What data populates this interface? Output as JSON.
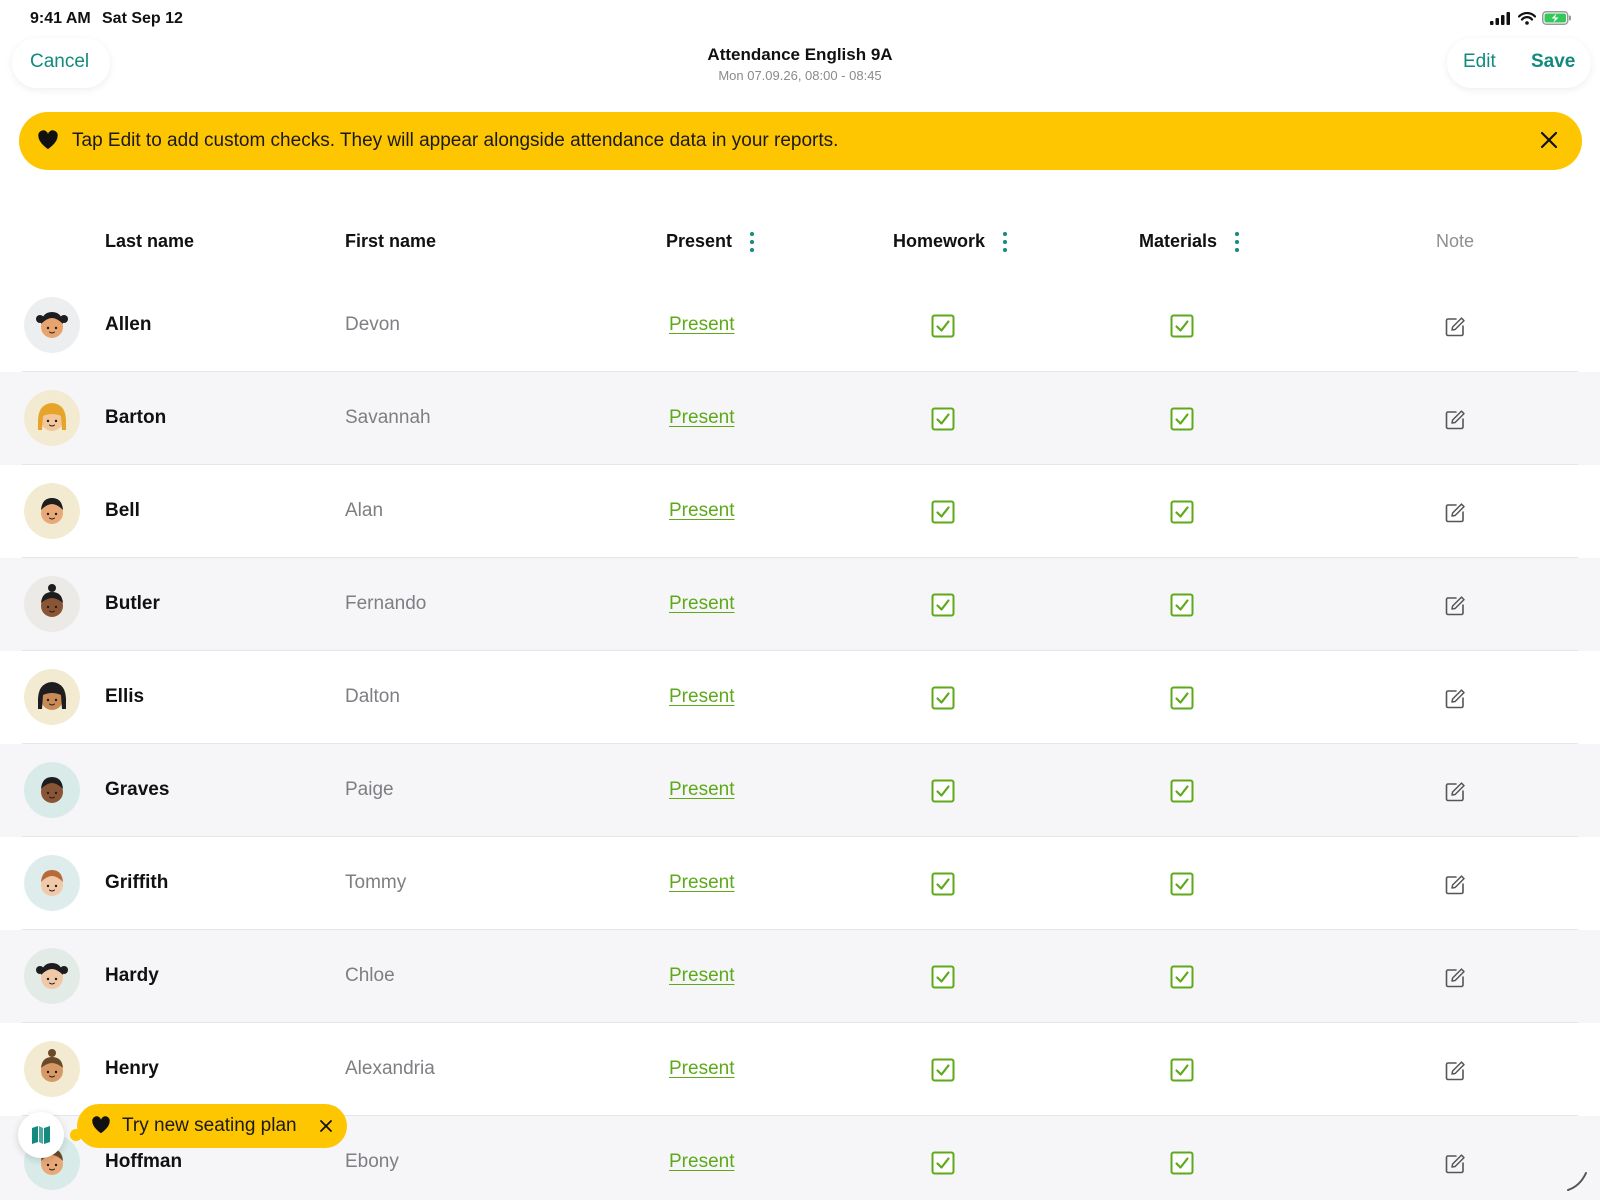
{
  "status_bar": {
    "time": "9:41 AM",
    "date": "Sat Sep 12",
    "battery_color": "#34c759"
  },
  "nav": {
    "cancel_label": "Cancel",
    "title": "Attendance English 9A",
    "subtitle": "Mon 07.09.26, 08:00 - 08:45",
    "edit_label": "Edit",
    "save_label": "Save",
    "accent_color": "#128a7e"
  },
  "banner": {
    "text": "Tap Edit to add custom checks. They will appear alongside attendance data in your reports.",
    "icon": "heart-icon",
    "close_icon": "close-icon",
    "color": "#fec501"
  },
  "table": {
    "headers": {
      "last_name": "Last name",
      "first_name": "First name",
      "present": "Present",
      "homework": "Homework",
      "materials": "Materials",
      "note": "Note"
    },
    "status_color": "#5ea91a",
    "rows": [
      {
        "last": "Allen",
        "first": "Devon",
        "status": "Present",
        "homework": true,
        "materials": true,
        "avatar": {
          "bg": "#eceef0",
          "skin": "#e7a46e",
          "hair": "#1d1d1f",
          "style": "bun-side"
        }
      },
      {
        "last": "Barton",
        "first": "Savannah",
        "status": "Present",
        "homework": true,
        "materials": true,
        "avatar": {
          "bg": "#f3ead2",
          "skin": "#f2c79c",
          "hair": "#e6a52a",
          "style": "long"
        }
      },
      {
        "last": "Bell",
        "first": "Alan",
        "status": "Present",
        "homework": true,
        "materials": true,
        "avatar": {
          "bg": "#f3ead2",
          "skin": "#e9a878",
          "hair": "#1d1d1f",
          "style": "short"
        }
      },
      {
        "last": "Butler",
        "first": "Fernando",
        "status": "Present",
        "homework": true,
        "materials": true,
        "avatar": {
          "bg": "#eceae6",
          "skin": "#8a5535",
          "hair": "#1d1d1f",
          "style": "topknot"
        }
      },
      {
        "last": "Ellis",
        "first": "Dalton",
        "status": "Present",
        "homework": true,
        "materials": true,
        "avatar": {
          "bg": "#f3ead2",
          "skin": "#c98a57",
          "hair": "#1d1d1f",
          "style": "long"
        }
      },
      {
        "last": "Graves",
        "first": "Paige",
        "status": "Present",
        "homework": true,
        "materials": true,
        "avatar": {
          "bg": "#d8ebe9",
          "skin": "#8a5535",
          "hair": "#1d1d1f",
          "style": "short"
        }
      },
      {
        "last": "Griffith",
        "first": "Tommy",
        "status": "Present",
        "homework": true,
        "materials": true,
        "avatar": {
          "bg": "#dfecec",
          "skin": "#f2c9a8",
          "hair": "#b86a3a",
          "style": "short"
        }
      },
      {
        "last": "Hardy",
        "first": "Chloe",
        "status": "Present",
        "homework": true,
        "materials": true,
        "avatar": {
          "bg": "#e3ebe6",
          "skin": "#f2c9a8",
          "hair": "#1d1d1f",
          "style": "bun-side"
        }
      },
      {
        "last": "Henry",
        "first": "Alexandria",
        "status": "Present",
        "homework": true,
        "materials": true,
        "avatar": {
          "bg": "#f3ead2",
          "skin": "#d79a66",
          "hair": "#6b4a2a",
          "style": "topknot"
        }
      },
      {
        "last": "Hoffman",
        "first": "Ebony",
        "status": "Present",
        "homework": true,
        "materials": true,
        "avatar": {
          "bg": "#d8ebe9",
          "skin": "#e9a878",
          "hair": "#6b4a2a",
          "style": "short"
        }
      }
    ]
  },
  "seating_toast": {
    "text": "Try new seating plan",
    "icon": "heart-icon",
    "map_icon": "map-icon",
    "close_icon": "close-icon"
  }
}
